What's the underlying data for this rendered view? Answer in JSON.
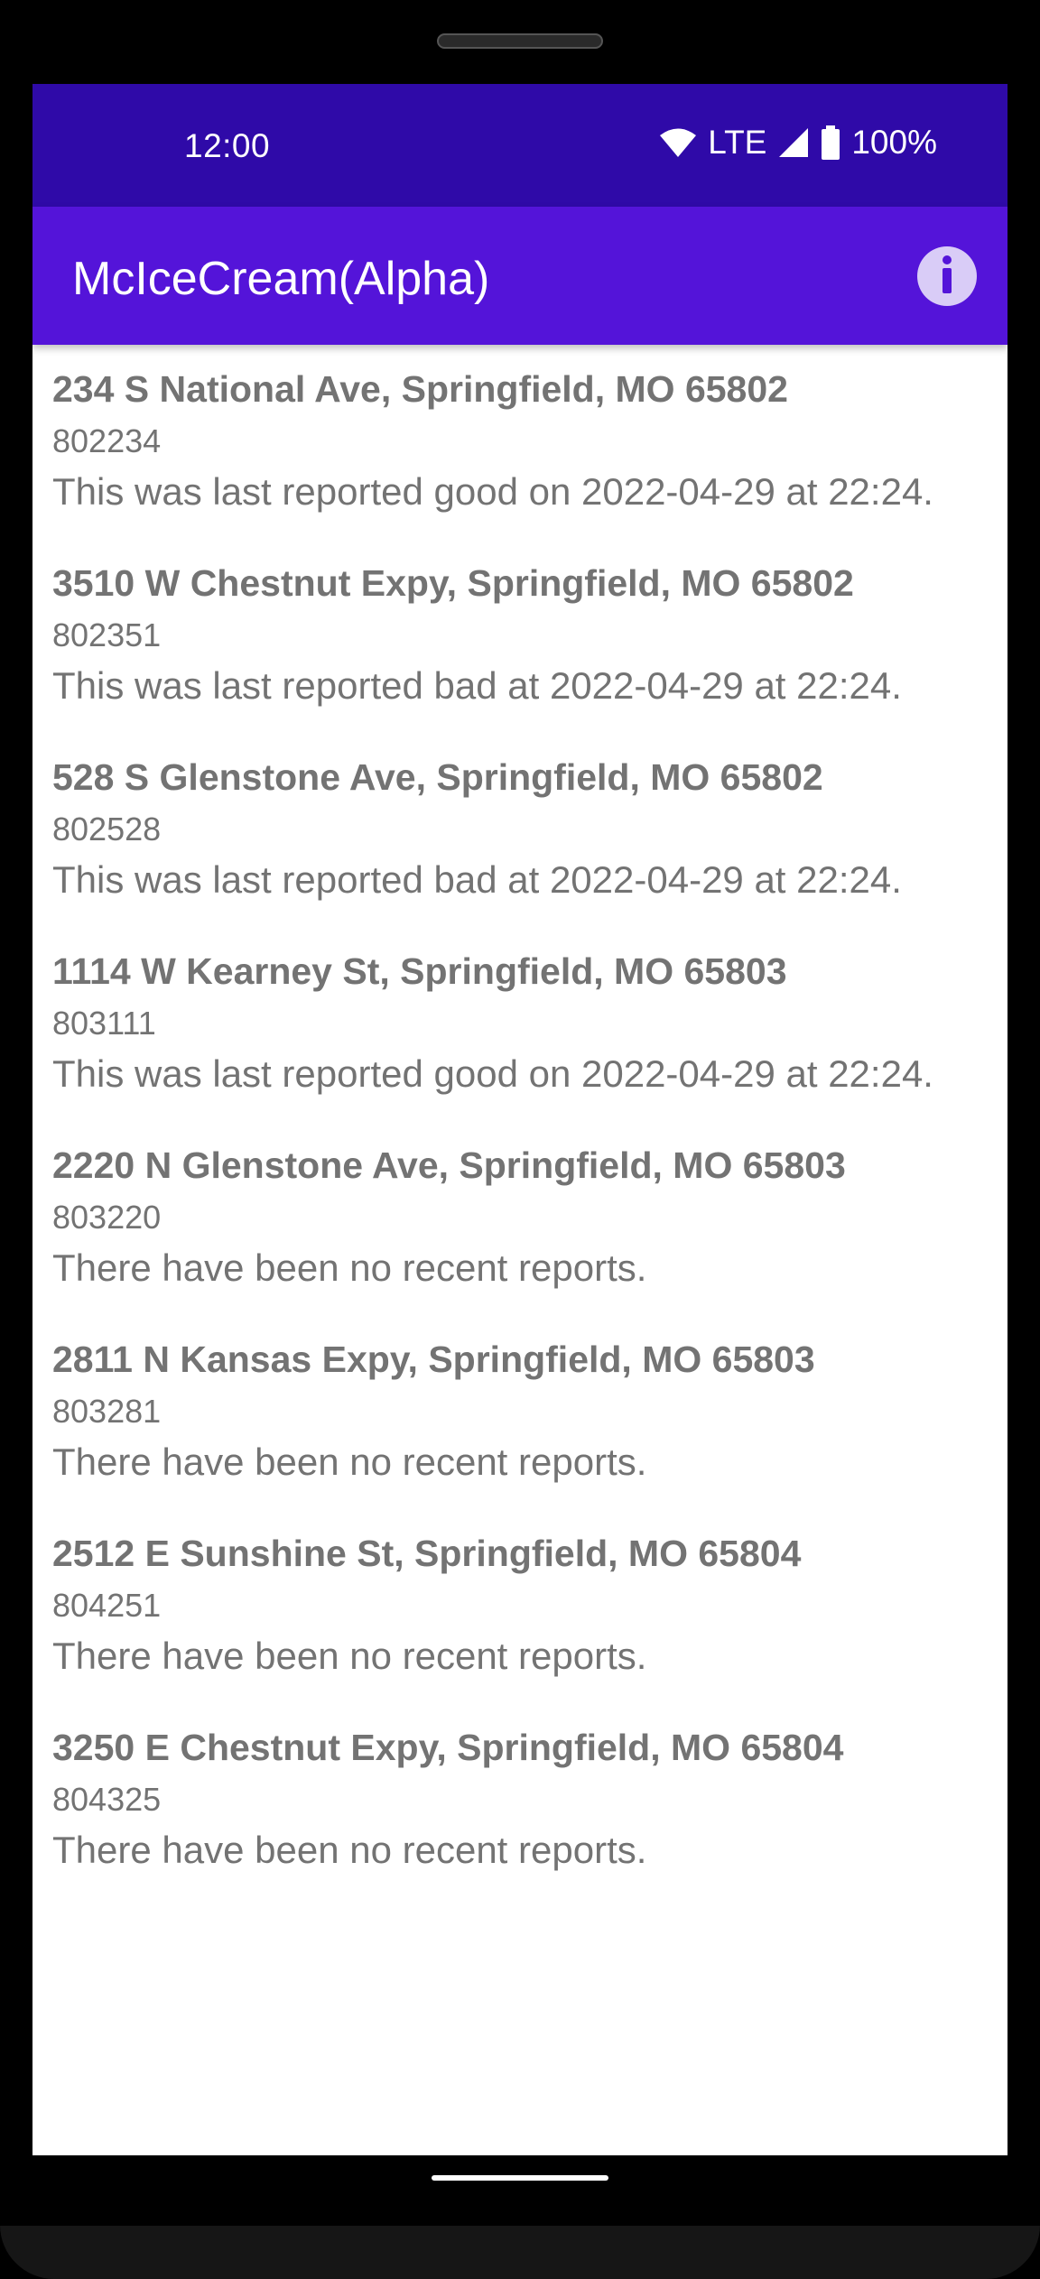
{
  "status_bar": {
    "time": "12:00",
    "network": "LTE",
    "battery": "100%",
    "icons": [
      "wifi-icon",
      "cell-signal-icon",
      "battery-icon"
    ]
  },
  "app_bar": {
    "title": "McIceCream(Alpha)",
    "action_icon": "info-icon"
  },
  "colors": {
    "status_bar": "#2f0aa8",
    "app_bar": "#5414d9",
    "info_button_bg": "#d9ccf7",
    "text": "#737373"
  },
  "locations": [
    {
      "address": "234 S National Ave, Springfield, MO 65802",
      "id": "802234",
      "status": "This was last reported good on 2022-04-29 at 22:24."
    },
    {
      "address": "3510 W Chestnut Expy, Springfield, MO 65802",
      "id": "802351",
      "status": "This was last reported bad at 2022-04-29 at 22:24."
    },
    {
      "address": "528 S Glenstone Ave, Springfield, MO 65802",
      "id": "802528",
      "status": "This was last reported bad at 2022-04-29 at 22:24."
    },
    {
      "address": "1114 W Kearney St, Springfield, MO 65803",
      "id": "803111",
      "status": "This was last reported good on 2022-04-29 at 22:24."
    },
    {
      "address": "2220 N Glenstone Ave, Springfield, MO 65803",
      "id": "803220",
      "status": "There have been no recent reports."
    },
    {
      "address": "2811 N Kansas Expy, Springfield, MO 65803",
      "id": "803281",
      "status": "There have been no recent reports."
    },
    {
      "address": "2512 E Sunshine St, Springfield, MO 65804",
      "id": "804251",
      "status": "There have been no recent reports."
    },
    {
      "address": "3250 E Chestnut Expy, Springfield, MO 65804",
      "id": "804325",
      "status": "There have been no recent reports."
    }
  ]
}
